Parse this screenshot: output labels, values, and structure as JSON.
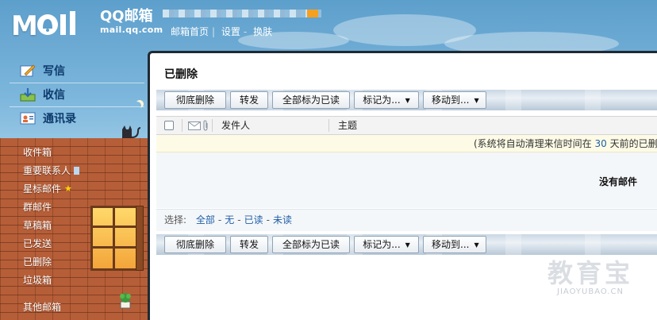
{
  "header": {
    "logo_text": "MOil",
    "brand_name": "QQ邮箱",
    "brand_url": "mail.qq.com",
    "top_links": [
      "邮箱首页",
      "设置",
      "换肤"
    ]
  },
  "sidebar": {
    "actions": [
      {
        "label": "写信",
        "icon": "compose-icon"
      },
      {
        "label": "收信",
        "icon": "inbox-download-icon"
      },
      {
        "label": "通讯录",
        "icon": "contacts-icon"
      }
    ],
    "folders": [
      {
        "label": "收件箱"
      },
      {
        "label": "重要联系人"
      },
      {
        "label": "星标邮件"
      },
      {
        "label": "群邮件"
      },
      {
        "label": "草稿箱"
      },
      {
        "label": "已发送"
      },
      {
        "label": "已删除"
      },
      {
        "label": "垃圾箱"
      },
      {
        "label": "其他邮箱"
      }
    ]
  },
  "main": {
    "folder_title": "已删除",
    "toolbar": {
      "delete_forever": "彻底删除",
      "forward": "转发",
      "mark_all_read": "全部标为已读",
      "mark_as": "标记为...",
      "move_to": "移动到..."
    },
    "columns": {
      "sender": "发件人",
      "subject": "主题"
    },
    "notice": {
      "prefix": "(系统将自动清理来信时间在",
      "days": "30",
      "suffix": "天前的已删"
    },
    "empty_text": "没有邮件",
    "select": {
      "label": "选择:",
      "all": "全部",
      "none": "无",
      "read": "已读",
      "unread": "未读"
    }
  },
  "watermark": {
    "cn": "教育宝",
    "en": "JIAOYUBAO.CN"
  },
  "colors": {
    "link": "#1f5ea8",
    "brick": "#b65e38",
    "sky": "#7cb6dc"
  }
}
